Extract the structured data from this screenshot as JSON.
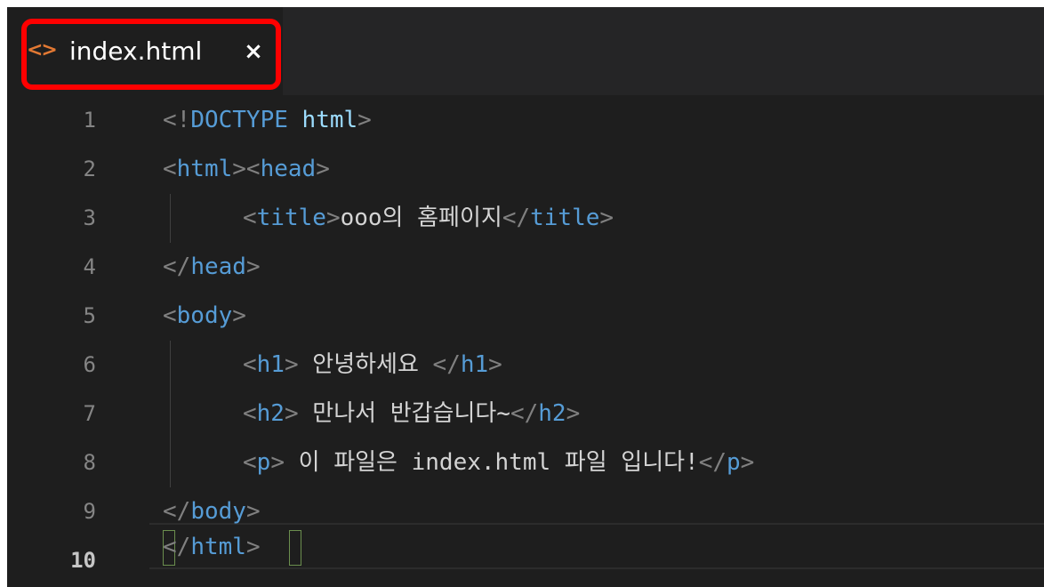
{
  "tab": {
    "icon": "html-file-icon",
    "icon_glyph": "<>",
    "filename": "index.html",
    "close_glyph": "×"
  },
  "editor": {
    "active_line": 10,
    "lines": [
      {
        "num": "1",
        "tokens": {
          "open": "<!",
          "name": "DOCTYPE",
          "rest": " html",
          "close": ">"
        }
      },
      {
        "num": "2",
        "tokens": {
          "a1": "<",
          "a2": "html",
          "a3": "><",
          "a4": "head",
          "a5": ">"
        }
      },
      {
        "num": "3",
        "tokens": {
          "b1": "<",
          "b2": "title",
          "b3": ">",
          "b4": "ooo의 홈페이지",
          "b5": "</",
          "b6": "title",
          "b7": ">"
        }
      },
      {
        "num": "4",
        "tokens": {
          "c1": "</",
          "c2": "head",
          "c3": ">"
        }
      },
      {
        "num": "5",
        "tokens": {
          "d1": "<",
          "d2": "body",
          "d3": ">"
        }
      },
      {
        "num": "6",
        "tokens": {
          "e1": "<",
          "e2": "h1",
          "e3": ">",
          "e4": " 안녕하세요 ",
          "e5": "</",
          "e6": "h1",
          "e7": ">"
        }
      },
      {
        "num": "7",
        "tokens": {
          "f1": "<",
          "f2": "h2",
          "f3": ">",
          "f4": " 만나서 반갑습니다~",
          "f5": "</",
          "f6": "h2",
          "f7": ">"
        }
      },
      {
        "num": "8",
        "tokens": {
          "g1": "<",
          "g2": "p",
          "g3": ">",
          "g4": " 이 파일은 index.html 파일 입니다!",
          "g5": "</",
          "g6": "p",
          "g7": ">"
        }
      },
      {
        "num": "9",
        "tokens": {
          "h1": "</",
          "h2": "body",
          "h3": ">"
        }
      },
      {
        "num": "10",
        "tokens": {
          "i1": "<",
          "i2": "/",
          "i3": "html",
          "i4": ">"
        }
      }
    ]
  },
  "colors": {
    "background": "#1e1e1e",
    "tag": "#569cd6",
    "bracket": "#808080",
    "text": "#d4d4d4",
    "icon": "#e37933",
    "highlight": "#ff0000"
  }
}
